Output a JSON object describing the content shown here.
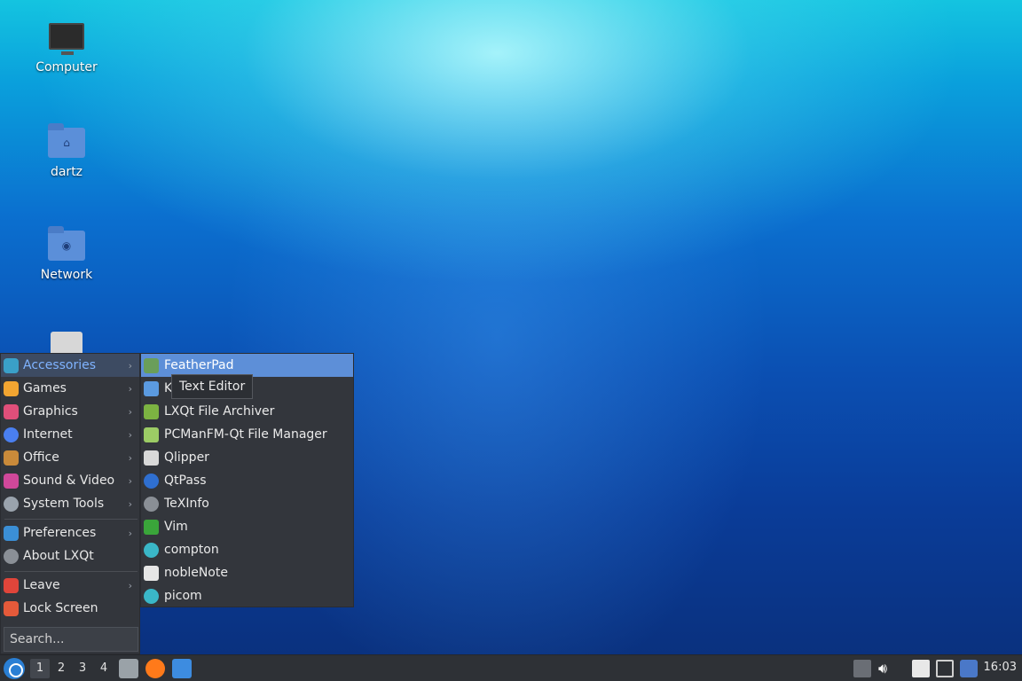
{
  "desktop": {
    "icons": [
      {
        "label": "Computer"
      },
      {
        "label": "dartz"
      },
      {
        "label": "Network"
      },
      {
        "label": ""
      }
    ]
  },
  "menu": {
    "categories": [
      {
        "label": "Accessories",
        "icon": "accessories-icon",
        "color": "#3aa0c8"
      },
      {
        "label": "Games",
        "icon": "games-icon",
        "color": "#f2a531"
      },
      {
        "label": "Graphics",
        "icon": "graphics-icon",
        "color": "#e04f7a"
      },
      {
        "label": "Internet",
        "icon": "internet-icon",
        "color": "#4a7ff0"
      },
      {
        "label": "Office",
        "icon": "office-icon",
        "color": "#c98a3a"
      },
      {
        "label": "Sound & Video",
        "icon": "sound-video-icon",
        "color": "#d0489a"
      },
      {
        "label": "System Tools",
        "icon": "system-tools-icon",
        "color": "#9aa3ad"
      }
    ],
    "preferences": {
      "label": "Preferences",
      "icon": "preferences-icon",
      "color": "#3b8fd6"
    },
    "about": {
      "label": "About LXQt",
      "icon": "info-icon",
      "color": "#8a8f96"
    },
    "leave": {
      "label": "Leave",
      "icon": "power-icon",
      "color": "#e0453a"
    },
    "lock": {
      "label": "Lock Screen",
      "icon": "lock-icon",
      "color": "#e55a3a"
    },
    "search_placeholder": "Search..."
  },
  "submenu": {
    "items": [
      {
        "label": "FeatherPad",
        "icon": "featherpad-icon",
        "color": "#6a9e5a"
      },
      {
        "label": "K",
        "icon": "calculator-icon",
        "color": "#5b9ae0"
      },
      {
        "label": "LXQt File Archiver",
        "icon": "archive-icon",
        "color": "#7cb342"
      },
      {
        "label": "PCManFM-Qt File Manager",
        "icon": "file-manager-icon",
        "color": "#9ccc65"
      },
      {
        "label": "Qlipper",
        "icon": "clipboard-icon",
        "color": "#d8d8d8"
      },
      {
        "label": "QtPass",
        "icon": "qtpass-icon",
        "color": "#2f6fd0"
      },
      {
        "label": "TeXInfo",
        "icon": "texinfo-icon",
        "color": "#8a8f96"
      },
      {
        "label": "Vim",
        "icon": "vim-icon",
        "color": "#3aa53a"
      },
      {
        "label": "compton",
        "icon": "compton-gear-icon",
        "color": "#3ab7c8"
      },
      {
        "label": "nobleNote",
        "icon": "notebook-icon",
        "color": "#e6e6e6"
      },
      {
        "label": "picom",
        "icon": "picom-gear-icon",
        "color": "#3ab7c8"
      }
    ]
  },
  "tooltip": {
    "text": "Text Editor"
  },
  "taskbar": {
    "workspaces": [
      "1",
      "2",
      "3",
      "4"
    ],
    "active_workspace": "1",
    "apps": [
      {
        "icon": "file-manager-icon",
        "color": "#9aa2a8"
      },
      {
        "icon": "firefox-icon",
        "color": "#ff7a1a"
      },
      {
        "icon": "desktop-icon",
        "color": "#3d8ce0"
      }
    ],
    "tray": [
      "tray-arrow-icon",
      "volume-icon",
      "clipboard-tray-icon",
      "network-icon",
      "update-notifier-icon"
    ],
    "clock": "16:03"
  }
}
